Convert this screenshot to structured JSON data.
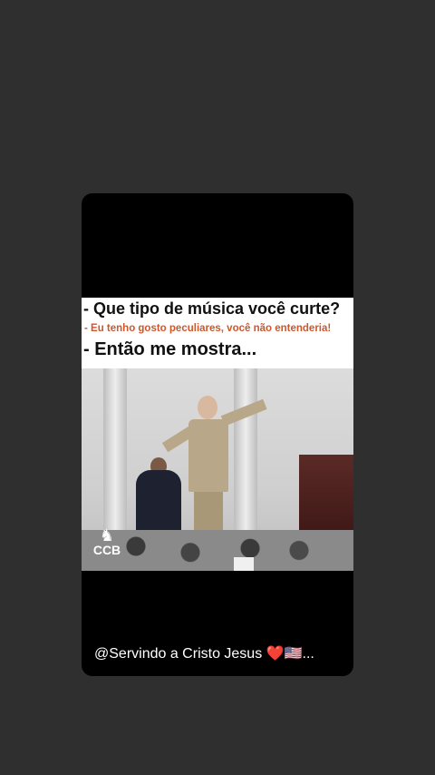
{
  "post": {
    "caption_line1": "- Que tipo de música você curte?",
    "caption_line2": "- Eu  tenho gosto peculiares, você não entenderia!",
    "caption_line3": "- Então me mostra...",
    "logo_text": "CCB",
    "handle": "@Servindo a Cristo Jesus",
    "heart": "❤️",
    "flag": "🇺🇸",
    "ellipsis": "..."
  }
}
